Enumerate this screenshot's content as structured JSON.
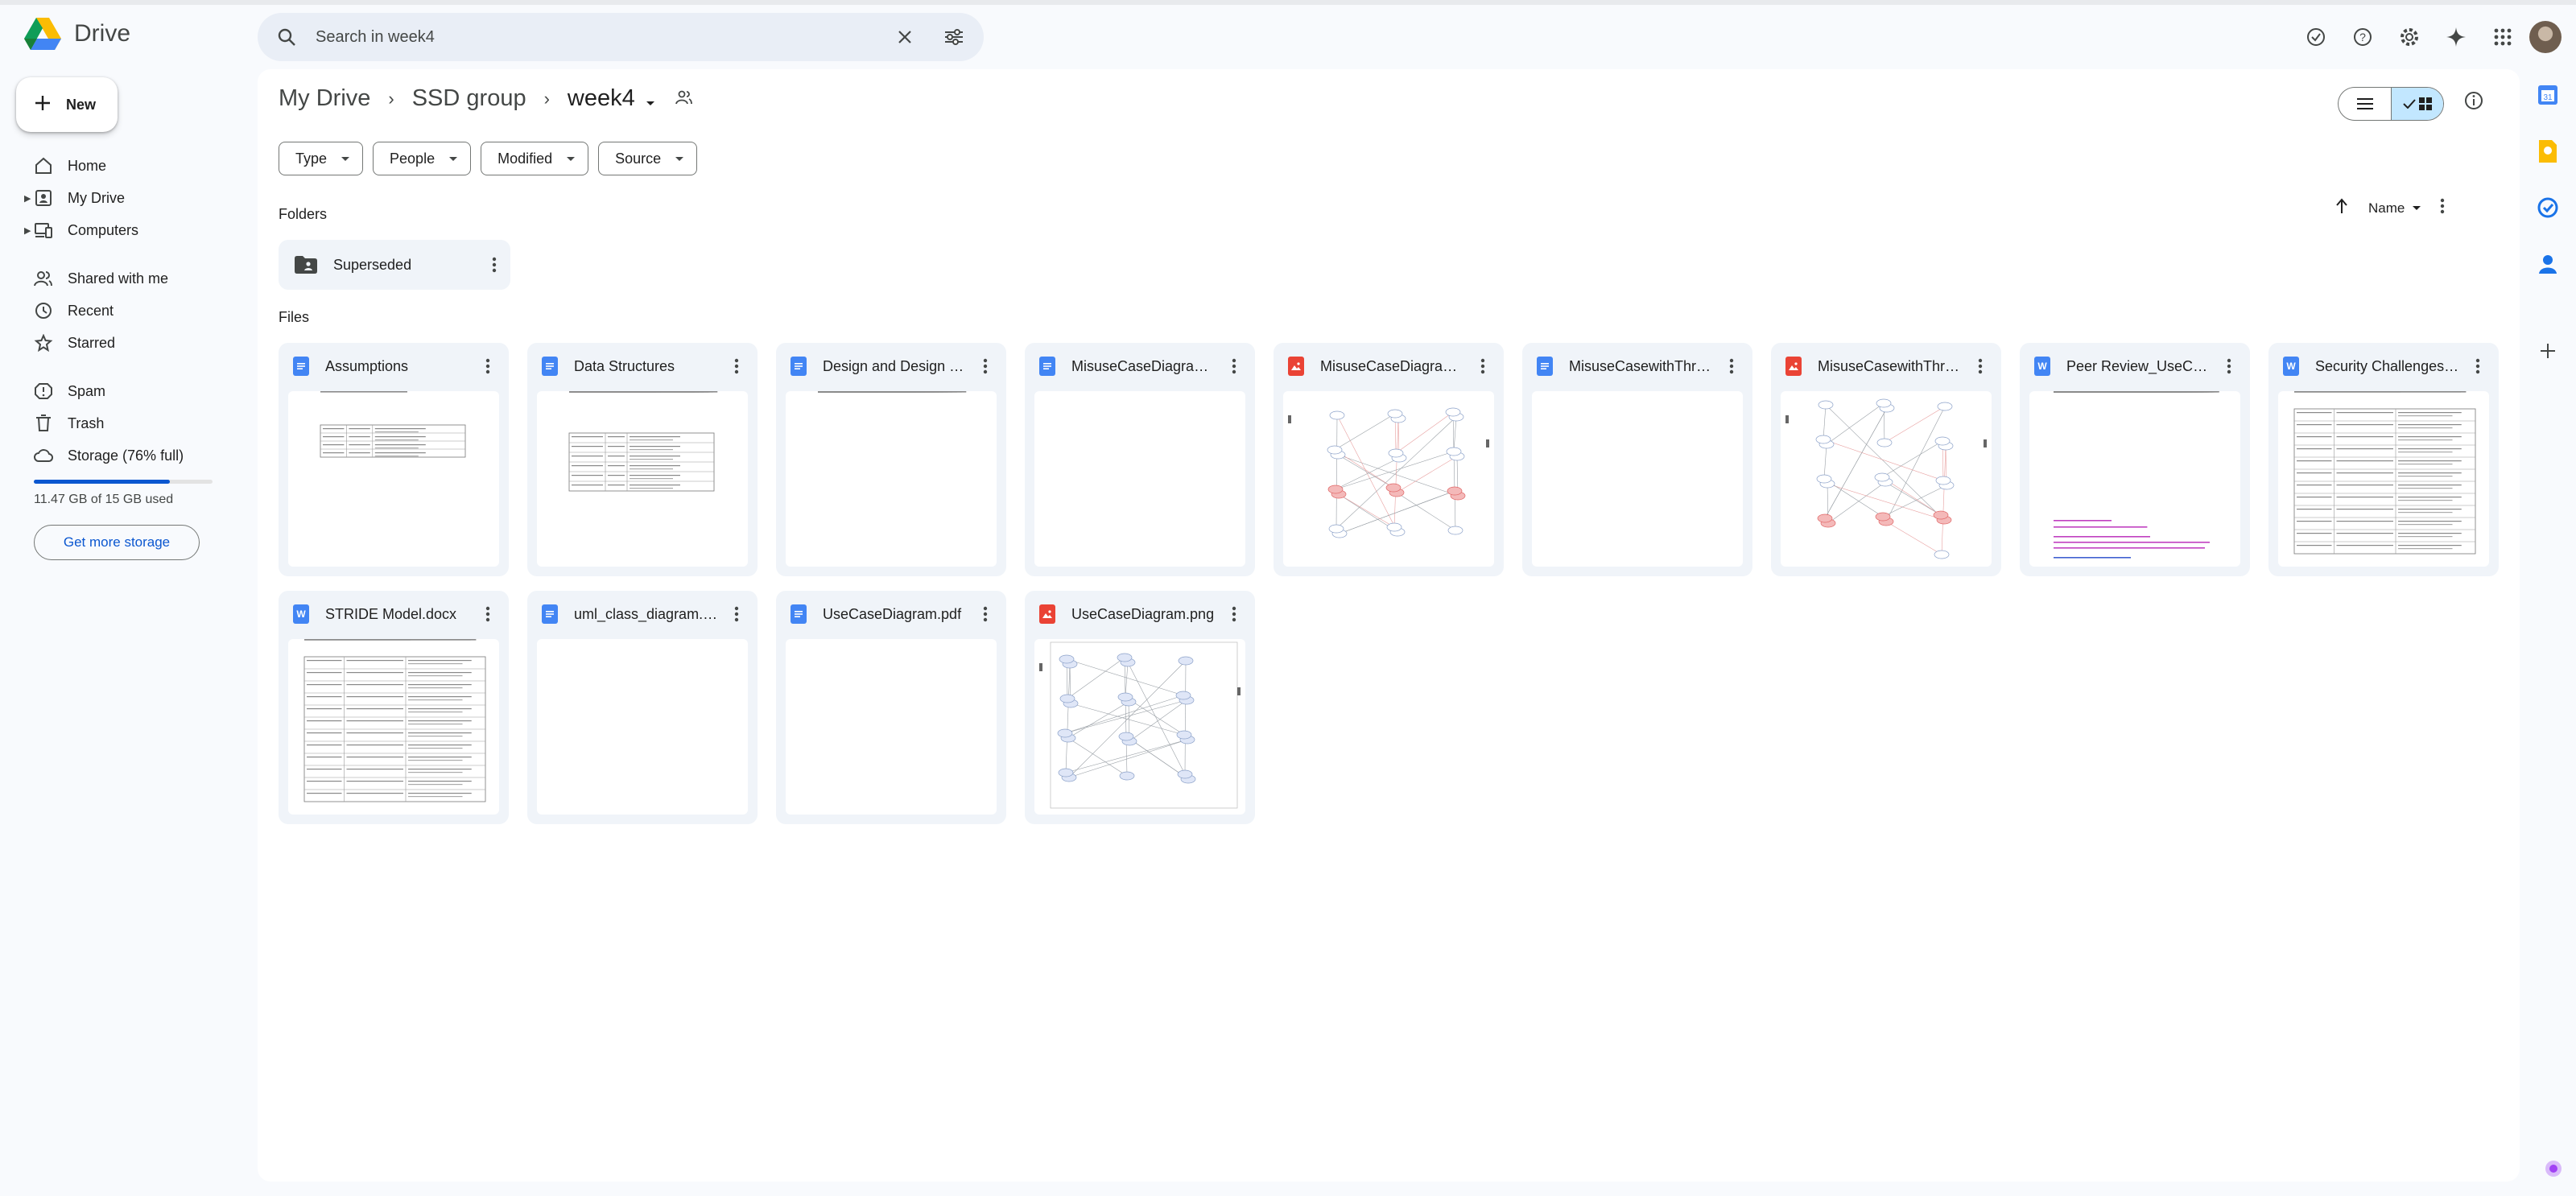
{
  "app": {
    "name": "Drive"
  },
  "search": {
    "placeholder": "Search in week4"
  },
  "sidebar": {
    "new_label": "New",
    "items": [
      {
        "label": "Home",
        "icon": "home-icon"
      },
      {
        "label": "My Drive",
        "icon": "my-drive-icon"
      },
      {
        "label": "Computers",
        "icon": "computers-icon"
      },
      {
        "label": "Shared with me",
        "icon": "shared-icon"
      },
      {
        "label": "Recent",
        "icon": "clock-icon"
      },
      {
        "label": "Starred",
        "icon": "star-icon"
      },
      {
        "label": "Spam",
        "icon": "spam-icon"
      },
      {
        "label": "Trash",
        "icon": "trash-icon"
      },
      {
        "label": "Storage (76% full)",
        "icon": "cloud-icon"
      }
    ],
    "storage": {
      "used_text": "11.47 GB of 15 GB used",
      "fraction_used": 0.76,
      "button_label": "Get more storage"
    }
  },
  "breadcrumb": {
    "items": [
      "My Drive",
      "SSD group",
      "week4"
    ]
  },
  "filters": [
    "Type",
    "People",
    "Modified",
    "Source"
  ],
  "sections": {
    "folders": "Folders",
    "files": "Files"
  },
  "sort": {
    "label": "Name"
  },
  "folders": [
    {
      "name": "Superseded"
    }
  ],
  "files": [
    {
      "name": "Assumptions",
      "type": "doc",
      "thumb": "table"
    },
    {
      "name": "Data Structures",
      "type": "doc",
      "thumb": "table-text"
    },
    {
      "name": "Design and Design Patterns",
      "type": "doc",
      "thumb": "text"
    },
    {
      "name": "MisuseCaseDiagram.pdf",
      "type": "doc",
      "thumb": "blank"
    },
    {
      "name": "MisuseCaseDiagram.png",
      "type": "image",
      "thumb": "diagram"
    },
    {
      "name": "MisuseCasewithThreats.pdf",
      "type": "doc",
      "thumb": "blank"
    },
    {
      "name": "MisuseCasewithThreats.png",
      "type": "image",
      "thumb": "diagram"
    },
    {
      "name": "Peer Review_UseCase.docx",
      "type": "word",
      "thumb": "text-color"
    },
    {
      "name": "Security Challenges.docx",
      "type": "word",
      "thumb": "table-dense"
    },
    {
      "name": "STRIDE Model.docx",
      "type": "word",
      "thumb": "table-dense"
    },
    {
      "name": "uml_class_diagram.pdf",
      "type": "doc",
      "thumb": "blank"
    },
    {
      "name": "UseCaseDiagram.pdf",
      "type": "doc",
      "thumb": "blank"
    },
    {
      "name": "UseCaseDiagram.png",
      "type": "image",
      "thumb": "usecase"
    }
  ],
  "colors": {
    "accent": "#0b57d0",
    "doc": "#4285f4",
    "image": "#ea4335",
    "selected_view": "#c2e7ff"
  }
}
